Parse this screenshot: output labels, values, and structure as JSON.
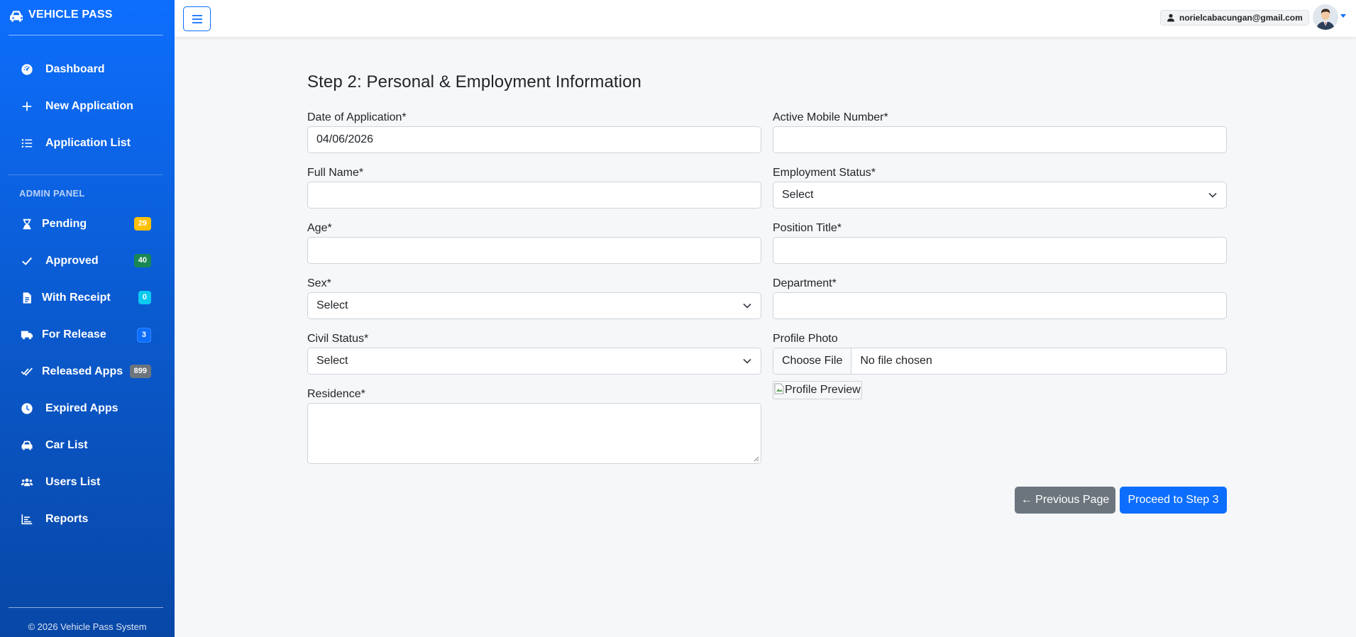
{
  "app": {
    "brand": "VEHICLE PASS",
    "footer": "© 2026 Vehicle Pass System"
  },
  "sidebar": {
    "items": [
      {
        "label": "Dashboard",
        "icon": "dashboard-icon"
      },
      {
        "label": "New Application",
        "icon": "plus-icon"
      },
      {
        "label": "Application List",
        "icon": "list-icon"
      }
    ],
    "admin_title": "ADMIN PANEL",
    "admin_items": [
      {
        "label": "Pending",
        "icon": "hourglass-icon",
        "badge": "29",
        "badge_color": "#ffc107"
      },
      {
        "label": "Approved",
        "icon": "check-icon",
        "badge": "40",
        "badge_color": "#198754"
      },
      {
        "label": "With Receipt",
        "icon": "receipt-icon",
        "badge": "0",
        "badge_color": "#0dcaf0"
      },
      {
        "label": "For Release",
        "icon": "truck-icon",
        "badge": "3",
        "badge_color": "#0d6efd"
      },
      {
        "label": "Released Apps",
        "icon": "double-check-icon",
        "badge": "899",
        "badge_color": "#6c757d"
      },
      {
        "label": "Expired Apps",
        "icon": "clock-icon"
      },
      {
        "label": "Car List",
        "icon": "car-icon"
      },
      {
        "label": "Users List",
        "icon": "users-icon"
      },
      {
        "label": "Reports",
        "icon": "chart-icon"
      }
    ]
  },
  "topbar": {
    "user_email": "norielcabacungan@gmail.com"
  },
  "form": {
    "title": "Step 2: Personal & Employment Information",
    "date_label": "Date of Application*",
    "date_value": "04/06/2026",
    "mobile_label": "Active Mobile Number*",
    "mobile_value": "",
    "fullname_label": "Full Name*",
    "fullname_value": "",
    "employment_label": "Employment Status*",
    "employment_value": "Select",
    "age_label": "Age*",
    "age_value": "",
    "position_label": "Position Title*",
    "position_value": "",
    "sex_label": "Sex*",
    "sex_value": "Select",
    "department_label": "Department*",
    "department_value": "",
    "civil_label": "Civil Status*",
    "civil_value": "Select",
    "photo_label": "Profile Photo",
    "file_button": "Choose File",
    "file_status": "No file chosen",
    "preview_alt": "Profile Preview",
    "residence_label": "Residence*",
    "residence_value": "",
    "prev_button": "← Previous Page",
    "next_button": "Proceed to Step 3"
  },
  "colors": {
    "primary": "#0d6efd",
    "secondary": "#6c757d",
    "sidebar_gradient_top": "#0d6efd",
    "sidebar_gradient_bottom": "#0847a6"
  }
}
